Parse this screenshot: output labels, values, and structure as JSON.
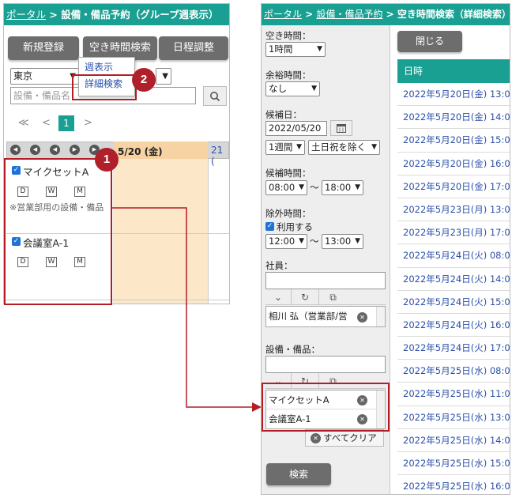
{
  "left": {
    "breadcrumb_link": "ポータル",
    "breadcrumb_sep": ">",
    "breadcrumb_current": "設備・備品予約（グループ週表示）",
    "buttons": {
      "new": "新規登録",
      "free_time": "空き時間検索",
      "schedule": "日程調整"
    },
    "dropdown_menu": {
      "week": "週表示",
      "detail": "詳細検索"
    },
    "location_select": "東京",
    "search_placeholder": "設備・備品名",
    "pagination": {
      "first": "≪",
      "prev": "<",
      "current": "1",
      "next": ">"
    },
    "date_header": "5/20 (金)",
    "date_header_next": "21 (",
    "items": [
      {
        "name": "マイクセットA",
        "note": "※営業部用の設備・備品"
      },
      {
        "name": "会議室A-1",
        "note": ""
      }
    ],
    "dwm": [
      "D",
      "W",
      "M"
    ]
  },
  "badges": {
    "one": "1",
    "two": "2"
  },
  "right": {
    "breadcrumb_link1": "ポータル",
    "breadcrumb_link2": "設備・備品予約",
    "breadcrumb_sep": ">",
    "breadcrumb_current": "空き時間検索（詳細検索）",
    "free_time_label": "空き時間：",
    "free_time_value": "1時間",
    "margin_label": "余裕時間：",
    "margin_value": "なし",
    "candidate_date_label": "候補日：",
    "candidate_date_value": "2022/05/20",
    "period_value": "1週間",
    "exclude_value": "土日祝を除く",
    "candidate_time_label": "候補時間：",
    "time_from": "08:00",
    "time_to": "18:00",
    "tilde": "〜",
    "exclude_time_label": "除外時間：",
    "use_label": "利用する",
    "ex_from": "12:00",
    "ex_to": "13:00",
    "employee_label": "社員：",
    "employee_value": "相川 弘（営業部/営",
    "equipment_label": "設備・備品：",
    "equipment_items": [
      "マイクセットA",
      "会議室A-1"
    ],
    "clear_all": "すべてクリア",
    "search_button": "検索",
    "close_button": "閉じる",
    "results_header": "日時",
    "results": [
      "2022年5月20日(金) 13:0",
      "2022年5月20日(金) 14:0",
      "2022年5月20日(金) 15:0",
      "2022年5月20日(金) 16:0",
      "2022年5月20日(金) 17:0",
      "2022年5月23日(月) 13:0",
      "2022年5月23日(月) 17:0",
      "2022年5月24日(火) 08:0",
      "2022年5月24日(火) 14:0",
      "2022年5月24日(火) 15:0",
      "2022年5月24日(火) 16:0",
      "2022年5月24日(火) 17:0",
      "2022年5月25日(水) 08:0",
      "2022年5月25日(水) 11:0",
      "2022年5月25日(水) 13:0",
      "2022年5月25日(水) 14:0",
      "2022年5月25日(水) 15:0",
      "2022年5月25日(水) 16:0"
    ]
  },
  "colors": {
    "teal": "#1aa092",
    "annotation_red": "#b51d24",
    "button_gray": "#6d6d6d",
    "link_blue": "#2b4fa8"
  }
}
